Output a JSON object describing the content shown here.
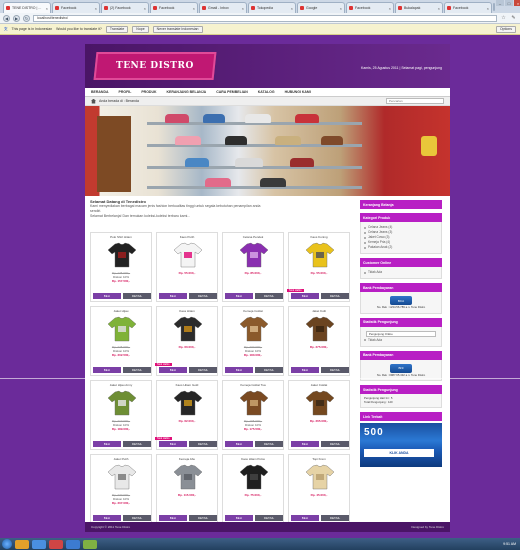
{
  "browser": {
    "tabs": [
      {
        "label": "TENE DISTRO | ...",
        "active": true
      },
      {
        "label": "Facebook"
      },
      {
        "label": "(2) Facebook"
      },
      {
        "label": "Facebook"
      },
      {
        "label": "Gmail - Inbox"
      },
      {
        "label": "Tokopedia"
      },
      {
        "label": "Google"
      },
      {
        "label": "Facebook"
      },
      {
        "label": "Bukalapak"
      },
      {
        "label": "Facebook"
      }
    ],
    "address": "localhost/tenedistro/",
    "translate_bar": {
      "message": "This page is in Indonesian",
      "question": "Would you like to translate it?",
      "translate_label": "Translate",
      "nope_label": "Nope",
      "never_label": "Never translate Indonesian",
      "options_label": "Options"
    }
  },
  "site": {
    "logo_text": "TENE DISTRO",
    "header_date": "Kamis, 25 Agustus 2011 | Selamat pagi, pengunjung",
    "menu": [
      "BERANDA",
      "PROFIL",
      "PRODUK",
      "KERANJANG BELANJA",
      "CARA PEMBELIAN",
      "KATALOG",
      "HUBUNGI KAMI"
    ],
    "breadcrumb": "Anda berada di : Beranda",
    "search_placeholder": "Pencarian",
    "welcome_title": "Selamat Datang di Tenedistro",
    "welcome_lines": [
      "Kami menyediakan berbagai macam jenis fashion berkualitas tinggi untuk segala kebutuhan penampilan anda",
      "sendiri.",
      "Selamat Berbelanja! Dan temukan koleksi-koleksi terbaru kami..."
    ],
    "products": [
      {
        "name": "Polo Shirt Hitam",
        "color": "#222222",
        "accent": "#9c1d1d",
        "old": "Rp. 175.000,-",
        "disc": "Diskon 10%",
        "new": "Rp. 157.500,-",
        "badge": ""
      },
      {
        "name": "Kaos Putih",
        "color": "#f4f4f4",
        "accent": "#e0107a",
        "old": "",
        "disc": "",
        "new": "Rp. 55.000,-",
        "badge": ""
      },
      {
        "name": "Celana Pendek",
        "color": "#8a2fb0",
        "accent": "#d6a3e6",
        "old": "",
        "disc": "",
        "new": "Rp. 85.000,-",
        "badge": ""
      },
      {
        "name": "Kaos Kuning",
        "color": "#e9c21c",
        "accent": "#555555",
        "old": "",
        "disc": "",
        "new": "Rp. 55.000,-",
        "badge": "Stok Habis"
      },
      {
        "name": "Jaket Hijau",
        "color": "#7fb238",
        "accent": "#dddddd",
        "old": "Rp. 225.000,-",
        "disc": "Diskon 10%",
        "new": "Rp. 202.500,-",
        "badge": ""
      },
      {
        "name": "Kaos Hitam",
        "color": "#2b2b2b",
        "accent": "#c58a18",
        "old": "",
        "disc": "",
        "new": "Rp. 60.000,-",
        "badge": "Stok Habis"
      },
      {
        "name": "Kemeja Coklat",
        "color": "#8b5a2b",
        "accent": "#d9b98a",
        "old": "Rp. 200.000,-",
        "disc": "Diskon 10%",
        "new": "Rp. 180.000,-",
        "badge": ""
      },
      {
        "name": "Jaket Kulit",
        "color": "#6b4420",
        "accent": "#3a2510",
        "old": "",
        "disc": "",
        "new": "Rp. 275.000,-",
        "badge": ""
      },
      {
        "name": "Jaket Hijau Army",
        "color": "#6e8e34",
        "accent": "#e2e2e2",
        "old": "Rp. 210.000,-",
        "disc": "Diskon 10%",
        "new": "Rp. 189.000,-",
        "badge": ""
      },
      {
        "name": "Kaos Hitam Gold",
        "color": "#262626",
        "accent": "#c8941c",
        "old": "",
        "disc": "",
        "new": "Rp. 62.000,-",
        "badge": "Stok Habis"
      },
      {
        "name": "Kemeja Coklat Tua",
        "color": "#7a4a22",
        "accent": "#caa36f",
        "old": "Rp. 195.000,-",
        "disc": "Diskon 10%",
        "new": "Rp. 175.500,-",
        "badge": ""
      },
      {
        "name": "Jaket Coklat",
        "color": "#74481f",
        "accent": "#3b2a18",
        "old": "",
        "disc": "",
        "new": "Rp. 265.000,-",
        "badge": ""
      },
      {
        "name": "Jaket Putih",
        "color": "#e8e8e8",
        "accent": "#7a7a7a",
        "old": "Rp. 230.000,-",
        "disc": "Diskon 10%",
        "new": "Rp. 207.000,-",
        "badge": ""
      },
      {
        "name": "Kemeja Abu",
        "color": "#8a8f96",
        "accent": "#5a5f66",
        "old": "",
        "disc": "",
        "new": "Rp. 115.000,-",
        "badge": ""
      },
      {
        "name": "Kaos Hitam Polos",
        "color": "#1f1f1f",
        "accent": "#444444",
        "old": "",
        "disc": "",
        "new": "Rp. 75.000,-",
        "badge": ""
      },
      {
        "name": "Topi Krem",
        "color": "#e6d3a6",
        "accent": "#b8a070",
        "old": "",
        "disc": "",
        "new": "Rp. 45.000,-",
        "badge": ""
      }
    ],
    "buy_label": "BELI",
    "detail_label": "DETAIL",
    "sidebar": {
      "cart_title": "Keranjang Belanja",
      "category_title": "Kategori Produk",
      "categories": [
        "Celana Jeans (4)",
        "Celana Jeans (3)",
        "Jaket Cowo (3)",
        "Kemeja Pria (4)",
        "Pakaian Anak (2)"
      ],
      "customer_title": "Customer Online",
      "customer_item": "Tidak Ada",
      "bank1_title": "Bank Pembayaran",
      "bank1_logo": "BCA",
      "bank1_text": "No. Rek : 1234.56.789 a.n. Tene Distro",
      "shipping_title": "Statistik Pengunjung",
      "shipping_option": "Pengunjung Online",
      "visitor_item": "Tidak Ada",
      "bank2_title": "Bank Pembayaran",
      "bank2_logo": "BNI",
      "bank2_text": "No. Rek : 0987.65.432 a.n. Tene Distro",
      "stats_title": "Statistik Pengunjung",
      "stats_items": [
        "Pengunjung Hari Ini : 5",
        "Total Pengunjung : 120"
      ],
      "link_title": "Link Terkait",
      "ad_big": "500 ",
      "ad_sub": "KLIK ANDA"
    },
    "footer_left": "Copyright © 2011 Tene Distro",
    "footer_right": "Designed by Tene Distro"
  },
  "taskbar": {
    "clock": "9:51 AM"
  }
}
